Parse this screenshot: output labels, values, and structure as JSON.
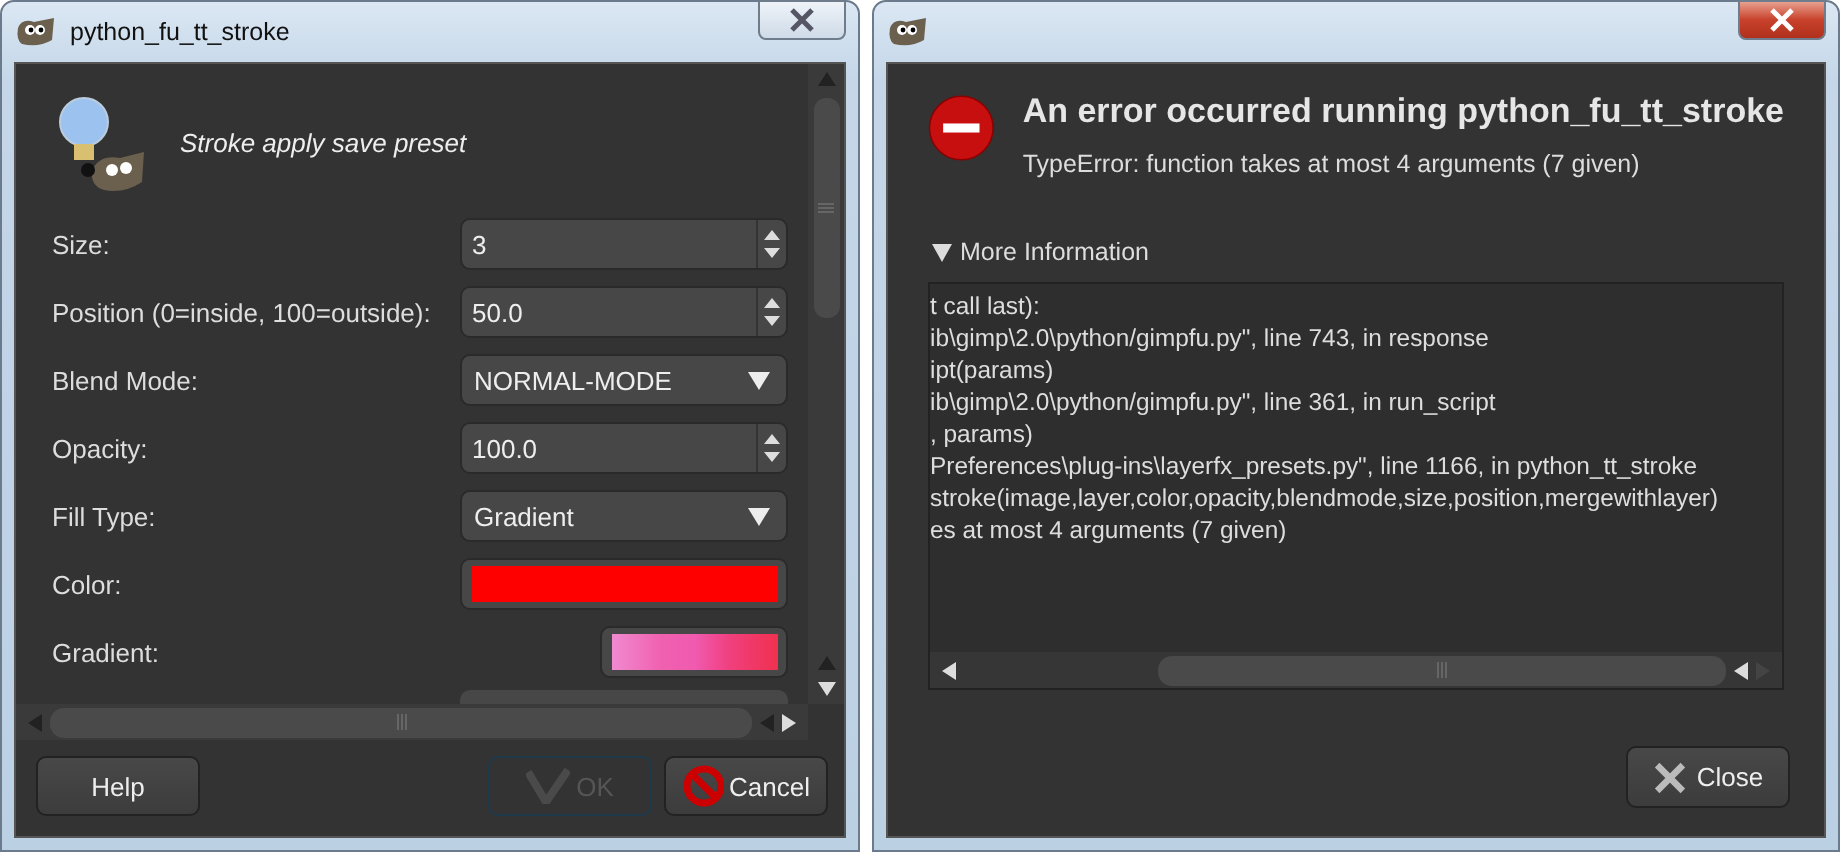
{
  "plugin_dialog": {
    "title": "python_fu_tt_stroke",
    "description": "Stroke apply save preset",
    "fields": [
      {
        "kind": "spin",
        "label": "Size:",
        "value": "3"
      },
      {
        "kind": "spin",
        "label": "Position (0=inside, 100=outside):",
        "value": "50.0"
      },
      {
        "kind": "combo",
        "label": "Blend Mode:",
        "value": "NORMAL-MODE"
      },
      {
        "kind": "spin",
        "label": "Opacity:",
        "value": "100.0"
      },
      {
        "kind": "combo",
        "label": "Fill Type:",
        "value": "Gradient"
      },
      {
        "kind": "color",
        "label": "Color:",
        "color": "#ff0000"
      },
      {
        "kind": "gradient",
        "label": "Gradient:"
      }
    ],
    "buttons": [
      {
        "kind": "help",
        "label": "Help",
        "disabled": false
      },
      {
        "kind": "ok",
        "label": "OK",
        "disabled": true
      },
      {
        "kind": "cancel",
        "label": "Cancel",
        "disabled": false
      }
    ]
  },
  "error_dialog": {
    "heading": "An error occurred running python_fu_tt_stroke",
    "message": "TypeError: function takes at most 4 arguments (7 given)",
    "details": {
      "label": "More Information",
      "expanded": true,
      "lines": [
        "t call last):",
        "ib\\gimp\\2.0\\python/gimpfu.py\", line 743, in response",
        "ipt(params)",
        "ib\\gimp\\2.0\\python/gimpfu.py\", line 361, in run_script",
        ", params)",
        "Preferences\\plug-ins\\layerfx_presets.py\", line 1166, in python_tt_stroke",
        "stroke(image,layer,color,opacity,blendmode,size,position,mergewithlayer)",
        "es at most 4 arguments (7 given)"
      ]
    },
    "close_button": "Close"
  }
}
